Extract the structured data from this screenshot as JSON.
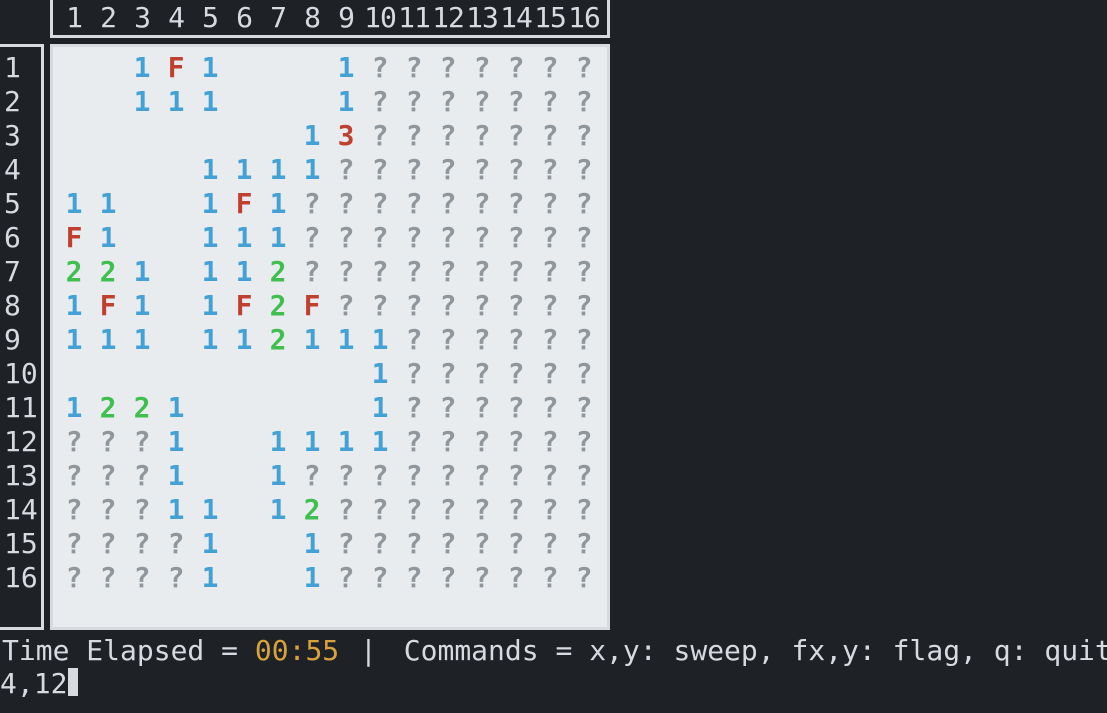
{
  "size": 16,
  "columns": [
    "1",
    "2",
    "3",
    "4",
    "5",
    "6",
    "7",
    "8",
    "9",
    "10",
    "11",
    "12",
    "13",
    "14",
    "15",
    "16"
  ],
  "rows": [
    "1",
    "2",
    "3",
    "4",
    "5",
    "6",
    "7",
    "8",
    "9",
    "10",
    "11",
    "12",
    "13",
    "14",
    "15",
    "16"
  ],
  "board": [
    [
      " ",
      " ",
      "1",
      "F",
      "1",
      " ",
      " ",
      " ",
      "1",
      "?",
      "?",
      "?",
      "?",
      "?",
      "?",
      "?"
    ],
    [
      " ",
      " ",
      "1",
      "1",
      "1",
      " ",
      " ",
      " ",
      "1",
      "?",
      "?",
      "?",
      "?",
      "?",
      "?",
      "?"
    ],
    [
      " ",
      " ",
      " ",
      " ",
      " ",
      " ",
      " ",
      "1",
      "3",
      "?",
      "?",
      "?",
      "?",
      "?",
      "?",
      "?"
    ],
    [
      " ",
      " ",
      " ",
      " ",
      "1",
      "1",
      "1",
      "1",
      "?",
      "?",
      "?",
      "?",
      "?",
      "?",
      "?",
      "?"
    ],
    [
      "1",
      "1",
      " ",
      " ",
      "1",
      "F",
      "1",
      "?",
      "?",
      "?",
      "?",
      "?",
      "?",
      "?",
      "?",
      "?"
    ],
    [
      "F",
      "1",
      " ",
      " ",
      "1",
      "1",
      "1",
      "?",
      "?",
      "?",
      "?",
      "?",
      "?",
      "?",
      "?",
      "?"
    ],
    [
      "2",
      "2",
      "1",
      " ",
      "1",
      "1",
      "2",
      "?",
      "?",
      "?",
      "?",
      "?",
      "?",
      "?",
      "?",
      "?"
    ],
    [
      "1",
      "F",
      "1",
      " ",
      "1",
      "F",
      "2",
      "F",
      "?",
      "?",
      "?",
      "?",
      "?",
      "?",
      "?",
      "?"
    ],
    [
      "1",
      "1",
      "1",
      " ",
      "1",
      "1",
      "2",
      "1",
      "1",
      "1",
      "?",
      "?",
      "?",
      "?",
      "?",
      "?"
    ],
    [
      " ",
      " ",
      " ",
      " ",
      " ",
      " ",
      " ",
      " ",
      " ",
      "1",
      "?",
      "?",
      "?",
      "?",
      "?",
      "?"
    ],
    [
      "1",
      "2",
      "2",
      "1",
      " ",
      " ",
      " ",
      " ",
      " ",
      "1",
      "?",
      "?",
      "?",
      "?",
      "?",
      "?"
    ],
    [
      "?",
      "?",
      "?",
      "1",
      " ",
      " ",
      "1",
      "1",
      "1",
      "1",
      "?",
      "?",
      "?",
      "?",
      "?",
      "?"
    ],
    [
      "?",
      "?",
      "?",
      "1",
      " ",
      " ",
      "1",
      "?",
      "?",
      "?",
      "?",
      "?",
      "?",
      "?",
      "?",
      "?"
    ],
    [
      "?",
      "?",
      "?",
      "1",
      "1",
      " ",
      "1",
      "2",
      "?",
      "?",
      "?",
      "?",
      "?",
      "?",
      "?",
      "?"
    ],
    [
      "?",
      "?",
      "?",
      "?",
      "1",
      " ",
      " ",
      "1",
      "?",
      "?",
      "?",
      "?",
      "?",
      "?",
      "?",
      "?"
    ],
    [
      "?",
      "?",
      "?",
      "?",
      "1",
      " ",
      " ",
      "1",
      "?",
      "?",
      "?",
      "?",
      "?",
      "?",
      "?",
      "?"
    ]
  ],
  "status": {
    "time_label": "Time Elapsed = ",
    "time_value": "00:55",
    "separator": "|",
    "commands_label": "Commands = ",
    "commands_hint": "x,y: sweep, fx,y: flag, q: quit"
  },
  "prompt_input": "4,12"
}
